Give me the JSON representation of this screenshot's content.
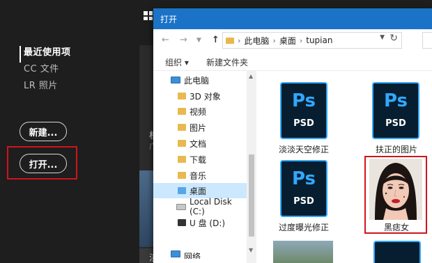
{
  "photoshop": {
    "nav": [
      {
        "label": "最近使用项",
        "active": true
      },
      {
        "label": "CC 文件",
        "active": false
      },
      {
        "label": "LR 照片",
        "active": false
      }
    ],
    "buttons": {
      "new": "新建...",
      "open": "打开..."
    },
    "partial_text": [
      "根",
      "广",
      "淡"
    ]
  },
  "dialog": {
    "title": "打开",
    "breadcrumb": [
      "此电脑",
      "桌面",
      "tupian"
    ],
    "commands": {
      "organize": "组织 ▾",
      "new_folder": "新建文件夹"
    },
    "tree": [
      {
        "label": "此电脑",
        "icon": "computer-icon"
      },
      {
        "label": "3D 对象",
        "icon": "folder-icon"
      },
      {
        "label": "视频",
        "icon": "folder-icon"
      },
      {
        "label": "图片",
        "icon": "folder-icon"
      },
      {
        "label": "文档",
        "icon": "folder-icon"
      },
      {
        "label": "下载",
        "icon": "folder-icon"
      },
      {
        "label": "音乐",
        "icon": "folder-icon"
      },
      {
        "label": "桌面",
        "icon": "folder-icon",
        "selected": true
      },
      {
        "label": "Local Disk (C:)",
        "icon": "disk-icon"
      },
      {
        "label": "U 盘 (D:)",
        "icon": "usb-drive-icon"
      },
      {
        "label": "网络",
        "icon": "network-icon"
      }
    ],
    "files": [
      {
        "name": "淡淡天空修正",
        "type": "PSD"
      },
      {
        "name": "扶正的图片",
        "type": "PSD"
      },
      {
        "name": "过度曝光修正",
        "type": "PSD"
      },
      {
        "name": "黑痣女",
        "type": "photo"
      }
    ],
    "psd_badge": "Ps",
    "psd_ext": "PSD"
  },
  "colors": {
    "accent_title": "#1a73c7",
    "highlight_red": "#d0141c",
    "ps_blue": "#31a8ff",
    "ps_dark": "#061e30"
  }
}
